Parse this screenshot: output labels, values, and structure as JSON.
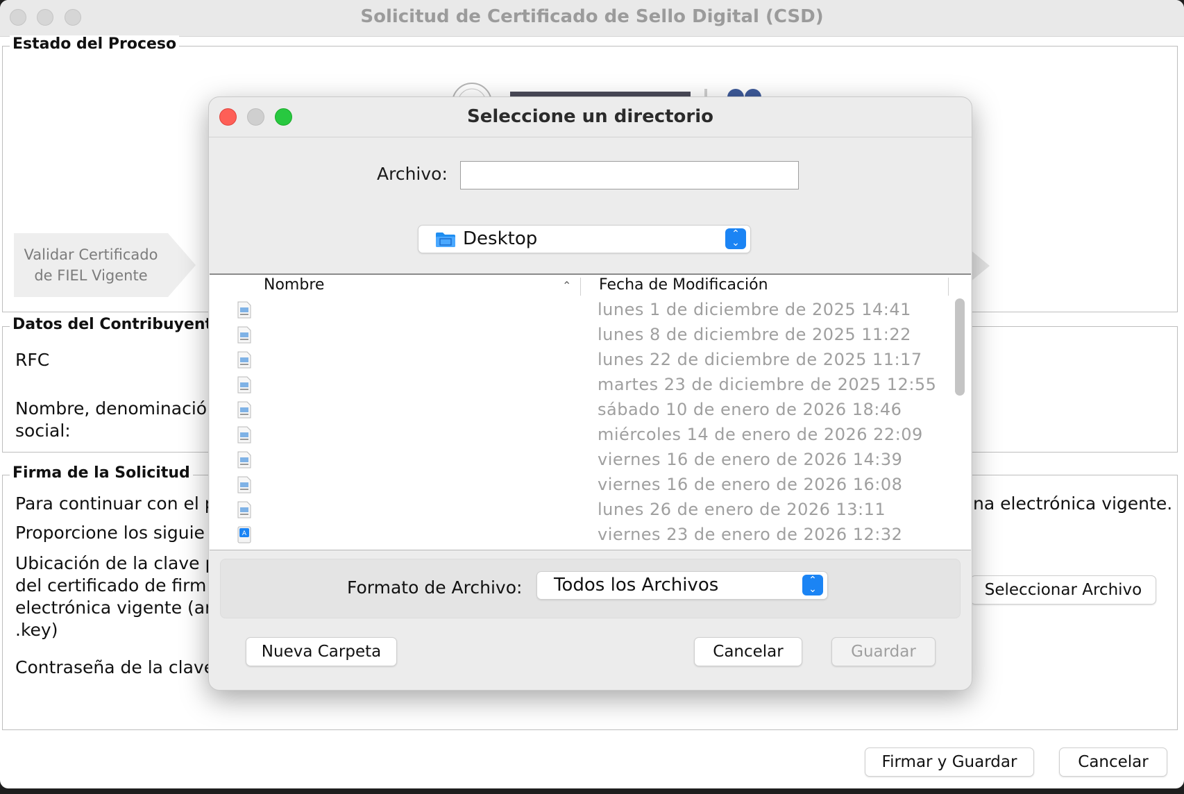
{
  "main_window": {
    "title": "Solicitud de Certificado de Sello Digital (CSD)",
    "estado_legend": "Estado del Proceso",
    "step1_line1": "Validar Certificado",
    "step1_line2": "de FIEL Vigente",
    "datos_legend": "Datos del Contribuyente",
    "rfc_label": "RFC",
    "nombre_label_line1": "Nombre, denominació",
    "nombre_label_line2": "social:",
    "firma_legend": "Firma de la Solicitud",
    "continuar_text": "Para continuar con el p",
    "continuar_text_right": "na electrónica vigente.",
    "proporcione_text": "Proporcione los siguie",
    "ubicacion_line1": "Ubicación de la clave p",
    "ubicacion_line2": "del certificado de firm",
    "ubicacion_line3": "electrónica vigente (ar",
    "ubicacion_line4": ".key)",
    "contrasena_label": "Contraseña de la clave",
    "seleccionar_archivo_button": "Seleccionar Archivo",
    "firmar_guardar_button": "Firmar y Guardar",
    "cancelar_button": "Cancelar"
  },
  "dialog": {
    "title": "Seleccione un directorio",
    "archivo_label": "Archivo:",
    "archivo_value": "",
    "location_selected": "Desktop",
    "columns": {
      "nombre": "Nombre",
      "fecha": "Fecha de Modificación"
    },
    "files": [
      {
        "name": "",
        "date": "lunes 1 de diciembre de 2025 14:41",
        "icon": "text-file-icon"
      },
      {
        "name": "",
        "date": "lunes 8 de diciembre de 2025 11:22",
        "icon": "text-file-icon"
      },
      {
        "name": "",
        "date": "lunes 22 de diciembre de 2025 11:17",
        "icon": "text-file-icon"
      },
      {
        "name": "",
        "date": "martes 23 de diciembre de 2025 12:55",
        "icon": "text-file-icon"
      },
      {
        "name": "",
        "date": "sábado 10 de enero de 2026 18:46",
        "icon": "text-file-icon"
      },
      {
        "name": "",
        "date": "miércoles 14 de enero de 2026 22:09",
        "icon": "text-file-icon"
      },
      {
        "name": "",
        "date": "viernes 16 de enero de 2026 14:39",
        "icon": "text-file-icon"
      },
      {
        "name": "",
        "date": "viernes 16 de enero de 2026 16:08",
        "icon": "text-file-icon"
      },
      {
        "name": "",
        "date": "lunes 26 de enero de 2026 13:11",
        "icon": "text-file-icon"
      },
      {
        "name": "",
        "date": "viernes 23 de enero de 2026 12:32",
        "icon": "app-file-icon"
      }
    ],
    "formato_label": "Formato de Archivo:",
    "formato_selected": "Todos los Archivos",
    "nueva_carpeta_button": "Nueva Carpeta",
    "cancelar_button": "Cancelar",
    "guardar_button": "Guardar"
  },
  "colors": {
    "close": "#fe5f57",
    "minimize": "#cfcfcf",
    "zoom": "#28c840",
    "accent": "#1b84f4",
    "disabled_text": "#9f9f9f"
  }
}
